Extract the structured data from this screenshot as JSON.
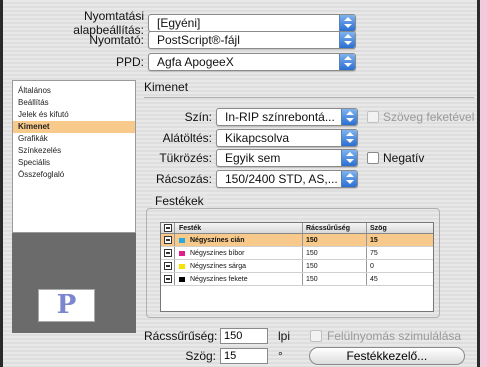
{
  "top": {
    "preset_label": "Nyomtatási alapbeállítás:",
    "preset_value": "[Egyéni]",
    "printer_label": "Nyomtató:",
    "printer_value": "PostScript®-fájl",
    "ppd_label": "PPD:",
    "ppd_value": "Agfa ApogeeX"
  },
  "sidebar": {
    "items": [
      {
        "label": "Általános"
      },
      {
        "label": "Beállítás"
      },
      {
        "label": "Jelek és kifutó"
      },
      {
        "label": "Kimenet"
      },
      {
        "label": "Grafikák"
      },
      {
        "label": "Színkezelés"
      },
      {
        "label": "Speciális"
      },
      {
        "label": "Összefoglaló"
      }
    ],
    "selected_index": 3,
    "logo_letter": "P"
  },
  "panel": {
    "title": "Kimenet",
    "color_label": "Szín:",
    "color_value": "In-RIP színrebontá...",
    "text_black_label": "Szöveg feketével",
    "trapping_label": "Alátöltés:",
    "trapping_value": "Kikapcsolva",
    "flip_label": "Tükrözés:",
    "flip_value": "Egyik sem",
    "negative_label": "Negatív",
    "screening_label": "Rácsozás:",
    "screening_value": "150/2400 STD, AS,..."
  },
  "inks": {
    "group_label": "Festékek",
    "columns": [
      "Festék",
      "Rácssűrűség",
      "Szög"
    ],
    "rows": [
      {
        "name": "Négyszínes cián",
        "frequency": "150",
        "angle": "15",
        "color": "#29a9e0"
      },
      {
        "name": "Négyszínes bíbor",
        "frequency": "150",
        "angle": "75",
        "color": "#e0208a"
      },
      {
        "name": "Négyszínes sárga",
        "frequency": "150",
        "angle": "0",
        "color": "#f5e400"
      },
      {
        "name": "Négyszínes fekete",
        "frequency": "150",
        "angle": "45",
        "color": "#000000"
      }
    ],
    "selected_index": 0
  },
  "bottom": {
    "frequency_label": "Rácssűrűség:",
    "frequency_value": "150",
    "frequency_unit": "lpi",
    "angle_label": "Szög:",
    "angle_value": "15",
    "angle_unit": "°",
    "overprint_label": "Felülnyomás szimulálása",
    "ink_manager_label": "Festékkezelő..."
  }
}
